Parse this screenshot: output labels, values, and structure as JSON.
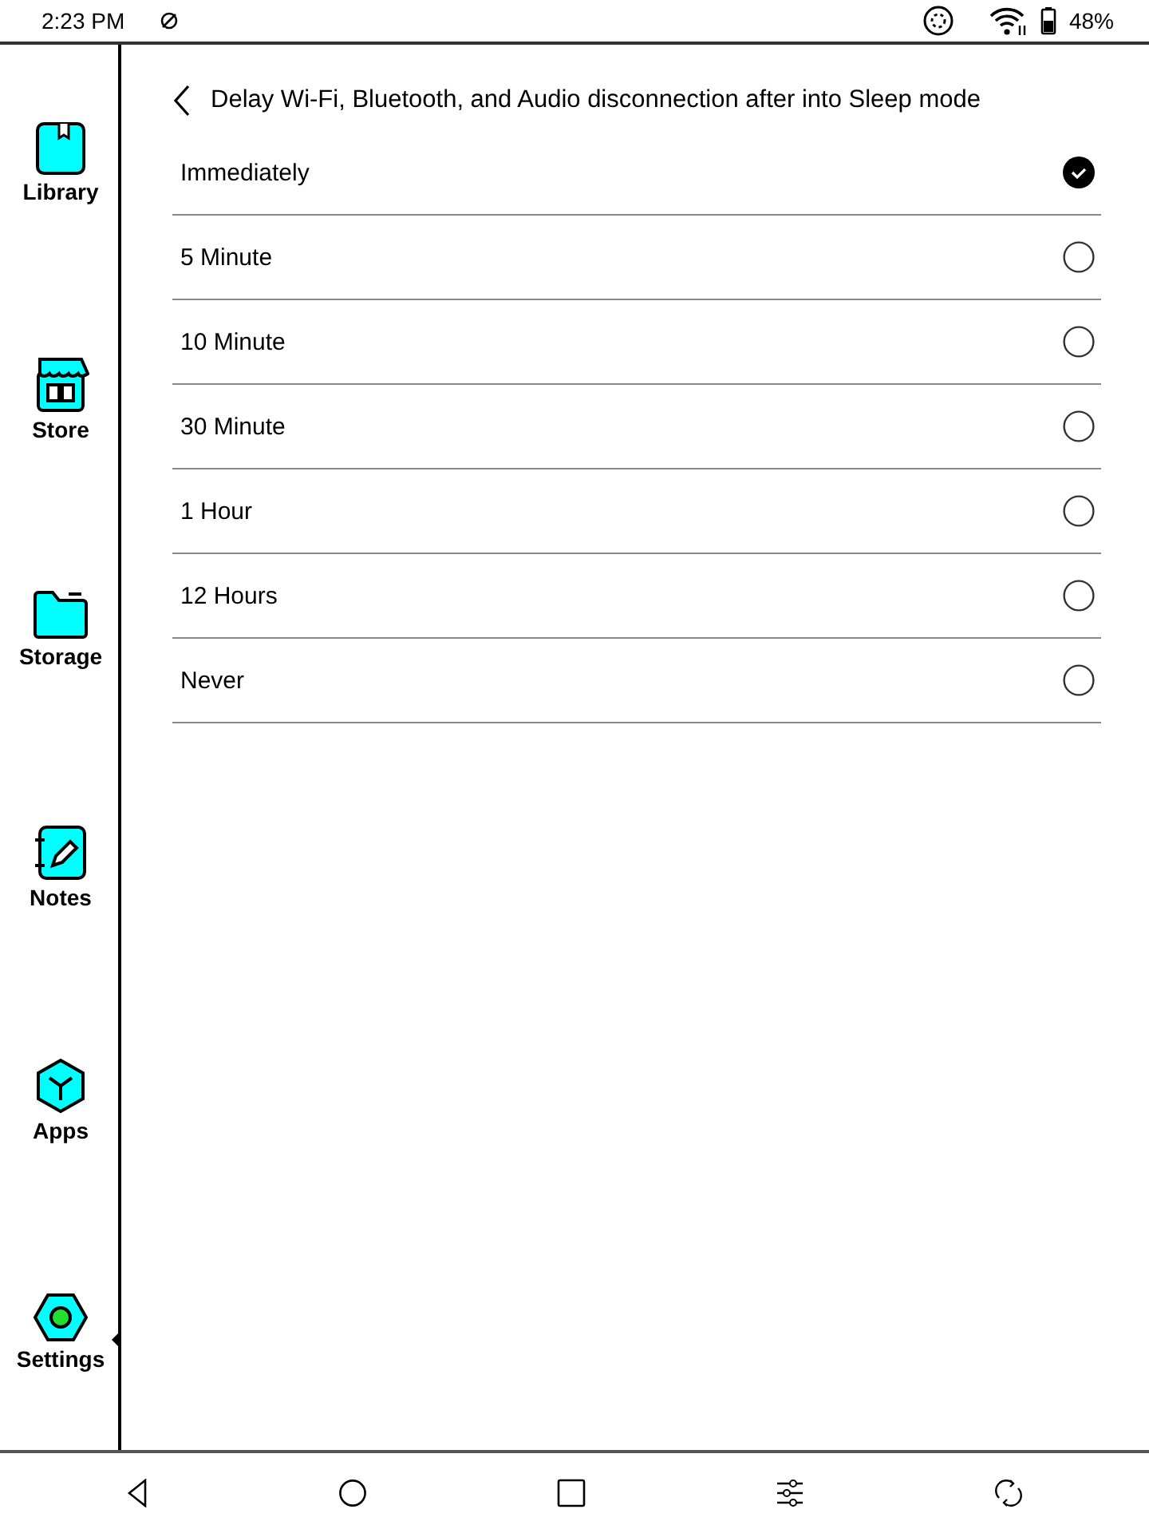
{
  "status_bar": {
    "time": "2:23 PM",
    "battery": "48%"
  },
  "sidebar": {
    "items": [
      {
        "kind": "library",
        "label": "Library",
        "selected": false
      },
      {
        "kind": "store",
        "label": "Store",
        "selected": false
      },
      {
        "kind": "storage",
        "label": "Storage",
        "selected": false
      },
      {
        "kind": "notes",
        "label": "Notes",
        "selected": false
      },
      {
        "kind": "apps",
        "label": "Apps",
        "selected": false
      },
      {
        "kind": "settings",
        "label": "Settings",
        "selected": true
      }
    ]
  },
  "page": {
    "title": "Delay Wi-Fi, Bluetooth, and Audio disconnection after into Sleep mode",
    "options": [
      {
        "label": "Immediately",
        "selected": true
      },
      {
        "label": "5 Minute",
        "selected": false
      },
      {
        "label": "10 Minute",
        "selected": false
      },
      {
        "label": "30 Minute",
        "selected": false
      },
      {
        "label": "1 Hour",
        "selected": false
      },
      {
        "label": "12 Hours",
        "selected": false
      },
      {
        "label": "Never",
        "selected": false
      }
    ]
  }
}
